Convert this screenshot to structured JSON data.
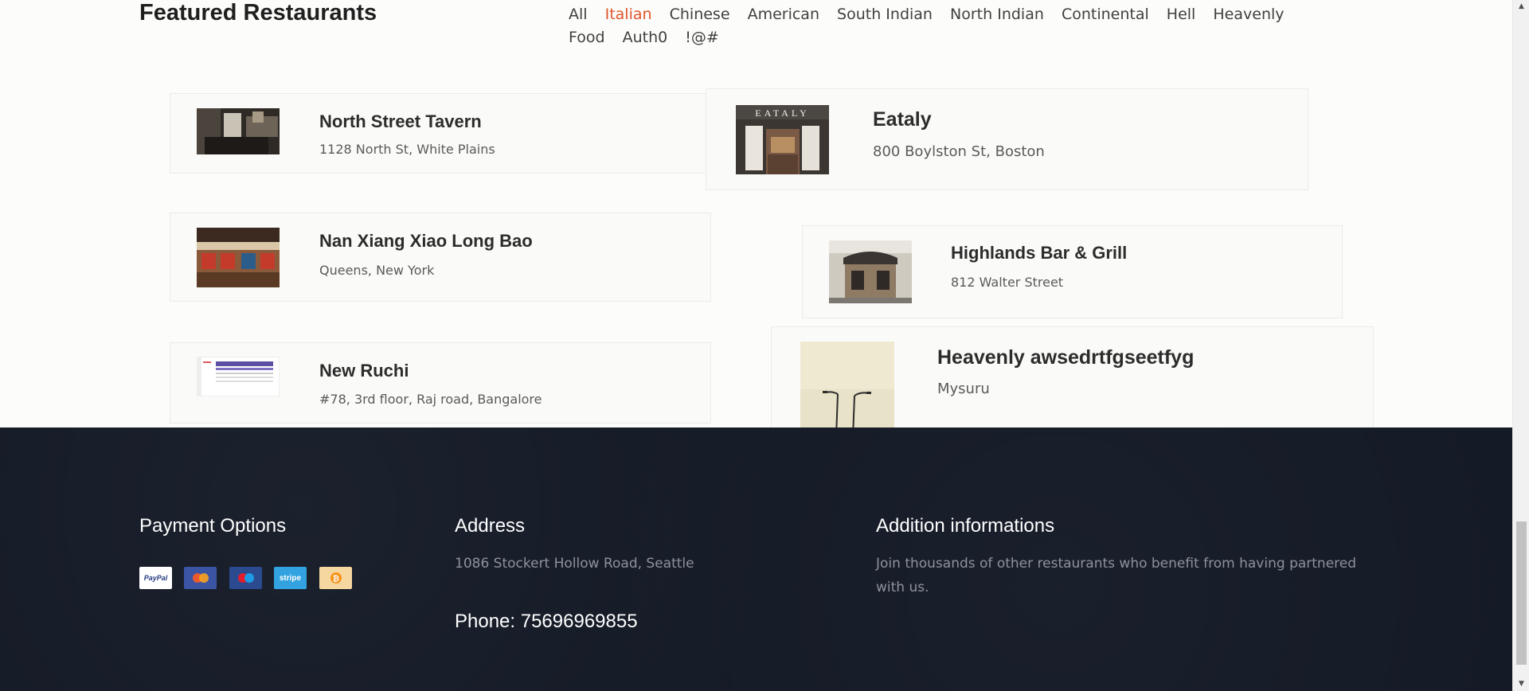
{
  "section": {
    "title": "Featured Restaurants",
    "filters": [
      "All",
      "Italian",
      "Chinese",
      "American",
      "South Indian",
      "North Indian",
      "Continental",
      "Hell",
      "Heavenly Food",
      "Auth0",
      "!@#"
    ],
    "active_filter": "Italian"
  },
  "restaurants": [
    {
      "name": "North Street Tavern",
      "address": "1128 North St, White Plains"
    },
    {
      "name": "Eataly",
      "address": "800 Boylston St, Boston",
      "sign": "EATALY"
    },
    {
      "name": "Nan Xiang Xiao Long Bao",
      "address": "Queens, New York"
    },
    {
      "name": "Highlands Bar & Grill",
      "address": "812 Walter Street"
    },
    {
      "name": "New Ruchi",
      "address": "#78, 3rd floor, Raj road, Bangalore"
    },
    {
      "name": "Heavenly awsedrtfgseetfyg",
      "address": "Mysuru"
    }
  ],
  "footer": {
    "payment_title": "Payment Options",
    "payment_methods": [
      "PayPal",
      "Mastercard",
      "Maestro",
      "stripe",
      "Bitcoin"
    ],
    "address_title": "Address",
    "address": "1086 Stockert Hollow Road, Seattle",
    "phone": "Phone: 75696969855",
    "info_title": "Addition informations",
    "info_text": "Join thousands of other restaurants who benefit from having partnered with us."
  },
  "colors": {
    "accent": "#e0552b",
    "footer_bg": "#141a26",
    "page_bg": "#fcfcfa"
  }
}
